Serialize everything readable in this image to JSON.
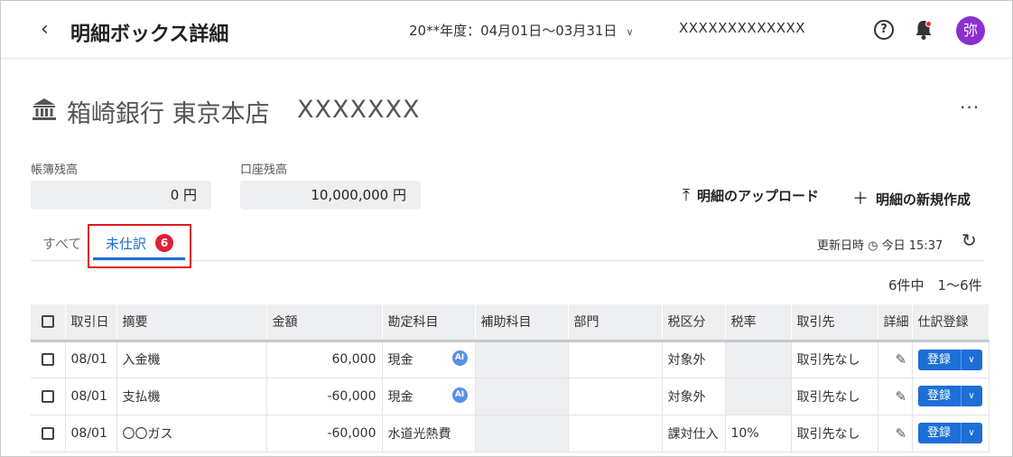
{
  "header": {
    "title": "明細ボックス詳細",
    "period": "20**年度：04月01日〜03月31日",
    "company": "XXXXXXXXXXXXX",
    "avatar_text": "弥",
    "notification_dot_color": "#e8263f",
    "avatar_color": "#8b2fd1"
  },
  "account": {
    "bank_name": "箱崎銀行 東京本店",
    "account_no": "XXXXXXX",
    "more": "···"
  },
  "balances": {
    "book_label": "帳簿残高",
    "book_value": "0 円",
    "account_label": "口座残高",
    "account_value": "10,000,000 円"
  },
  "actions": {
    "upload": "明細のアップロード",
    "create": "明細の新規作成"
  },
  "tabs": {
    "all": "すべて",
    "pending": "未仕訳",
    "pending_count": "6",
    "accent_color": "#1b6fd6"
  },
  "status": {
    "updated_label": "更新日時",
    "updated_value": "今日 15:37",
    "pager": "6件中　1〜6件"
  },
  "table": {
    "headers": [
      "取引日",
      "摘要",
      "金額",
      "勘定科目",
      "補助科目",
      "部門",
      "税区分",
      "税率",
      "取引先",
      "詳細",
      "仕訳登録"
    ],
    "ai_badge": "AI",
    "register_label": "登録",
    "rows": [
      {
        "date": "08/01",
        "summary": "入金機",
        "amount": "60,000",
        "account": "現金",
        "ai": true,
        "tax": "対象外",
        "rate": "",
        "partner": "取引先なし"
      },
      {
        "date": "08/01",
        "summary": "支払機",
        "amount": "-60,000",
        "account": "現金",
        "ai": true,
        "tax": "対象外",
        "rate": "",
        "partner": "取引先なし"
      },
      {
        "date": "08/01",
        "summary": "〇〇ガス",
        "amount": "-60,000",
        "account": "水道光熱費",
        "ai": false,
        "tax": "課対仕入",
        "rate": "10%",
        "partner": "取引先なし"
      }
    ]
  }
}
